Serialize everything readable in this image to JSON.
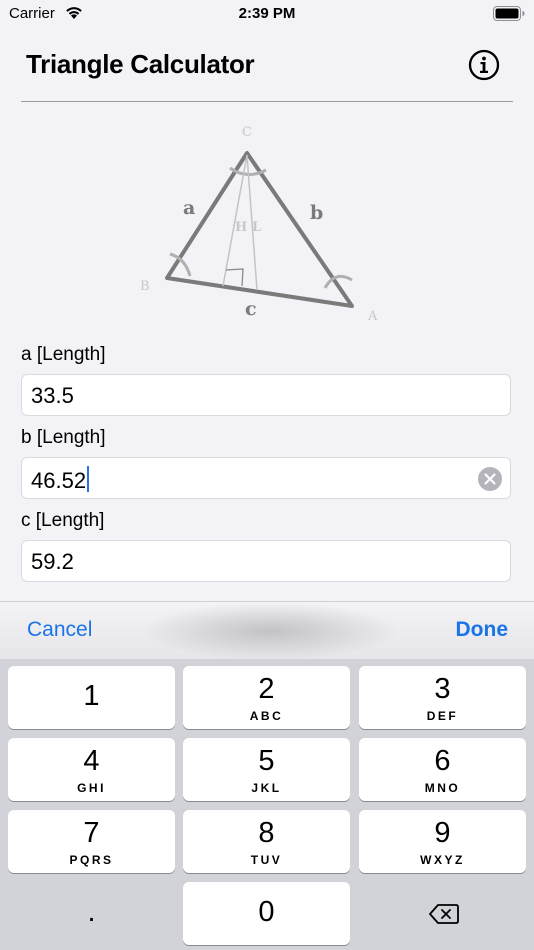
{
  "status_bar": {
    "carrier": "Carrier",
    "time": "2:39 PM"
  },
  "nav": {
    "title": "Triangle Calculator",
    "info_icon": "info-circle-icon"
  },
  "diagram": {
    "vertex_labels": {
      "A": "A",
      "B": "B",
      "C": "C"
    },
    "side_labels": {
      "a": "a",
      "b": "b",
      "c": "c"
    },
    "height_label": "H",
    "median_label": "L"
  },
  "fields": [
    {
      "label": "a [Length]",
      "value": "33.5"
    },
    {
      "label": "b [Length]",
      "value": "46.52"
    },
    {
      "label": "c [Length]",
      "value": "59.2"
    }
  ],
  "accessory": {
    "cancel": "Cancel",
    "done": "Done"
  },
  "keypad": {
    "keys": [
      {
        "digit": "1",
        "letters": ""
      },
      {
        "digit": "2",
        "letters": "ABC"
      },
      {
        "digit": "3",
        "letters": "DEF"
      },
      {
        "digit": "4",
        "letters": "GHI"
      },
      {
        "digit": "5",
        "letters": "JKL"
      },
      {
        "digit": "6",
        "letters": "MNO"
      },
      {
        "digit": "7",
        "letters": "PQRS"
      },
      {
        "digit": "8",
        "letters": "TUV"
      },
      {
        "digit": "9",
        "letters": "WXYZ"
      },
      {
        "digit": ".",
        "letters": ""
      },
      {
        "digit": "0",
        "letters": ""
      }
    ],
    "delete_icon": "delete-backspace-icon"
  },
  "colors": {
    "accent": "#1a73e8",
    "caret": "#2f6fe0",
    "keypad_bg": "#d1d3d9"
  }
}
